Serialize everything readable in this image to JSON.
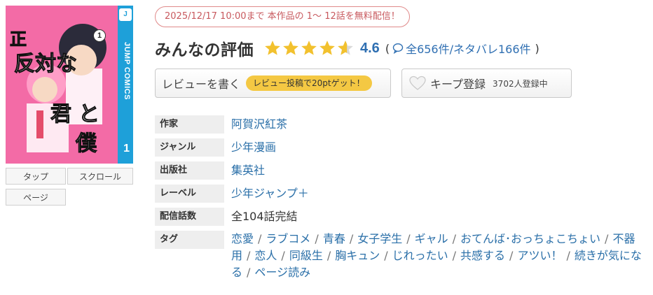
{
  "cover": {
    "imprint": "JUMP COMICS",
    "volume": "1",
    "title_chars": [
      "正",
      "反対な",
      "君",
      "と",
      "僕"
    ]
  },
  "view_buttons": [
    "タップ",
    "スクロール",
    "ページ"
  ],
  "promo": "2025/12/17 10:00まで 本作品の 1～ 12話を無料配信！",
  "rating": {
    "title": "みんなの評価",
    "score": "4.6",
    "open": "(",
    "counts_text": "全656件/ネタバレ166件",
    "close": ")"
  },
  "review_button": {
    "label": "レビューを書く",
    "pill": "レビュー投稿で20ptゲット！"
  },
  "keep_button": {
    "label": "キープ登録",
    "count": "3702人登録中"
  },
  "info": [
    {
      "label": "作家",
      "value": "阿賀沢紅茶"
    },
    {
      "label": "ジャンル",
      "value": "少年漫画"
    },
    {
      "label": "出版社",
      "value": "集英社"
    },
    {
      "label": "レーベル",
      "value": "少年ジャンプ＋"
    },
    {
      "label": "配信話数",
      "value": "全104話完結"
    }
  ],
  "tags_label": "タグ",
  "tags": [
    "恋愛",
    "ラブコメ",
    "青春",
    "女子学生",
    "ギャル",
    "おてんば･おっちょこちょい",
    "不器用",
    "恋人",
    "同級生",
    "胸キュン",
    "じれったい",
    "共感する",
    "アツい！",
    "続きが気になる",
    "ページ読み"
  ],
  "colors": {
    "promo": "#c8595e",
    "link": "#2a6fa8",
    "score": "#2f6fb2",
    "star": "#f2c12e",
    "pill": "#f4c843",
    "cover_pink": "#f36ba6",
    "cover_spine": "#1ea0d9"
  },
  "icons": {
    "rating_stars": "star-icon",
    "comment": "speech-bubble-icon",
    "keep": "heart-icon"
  }
}
